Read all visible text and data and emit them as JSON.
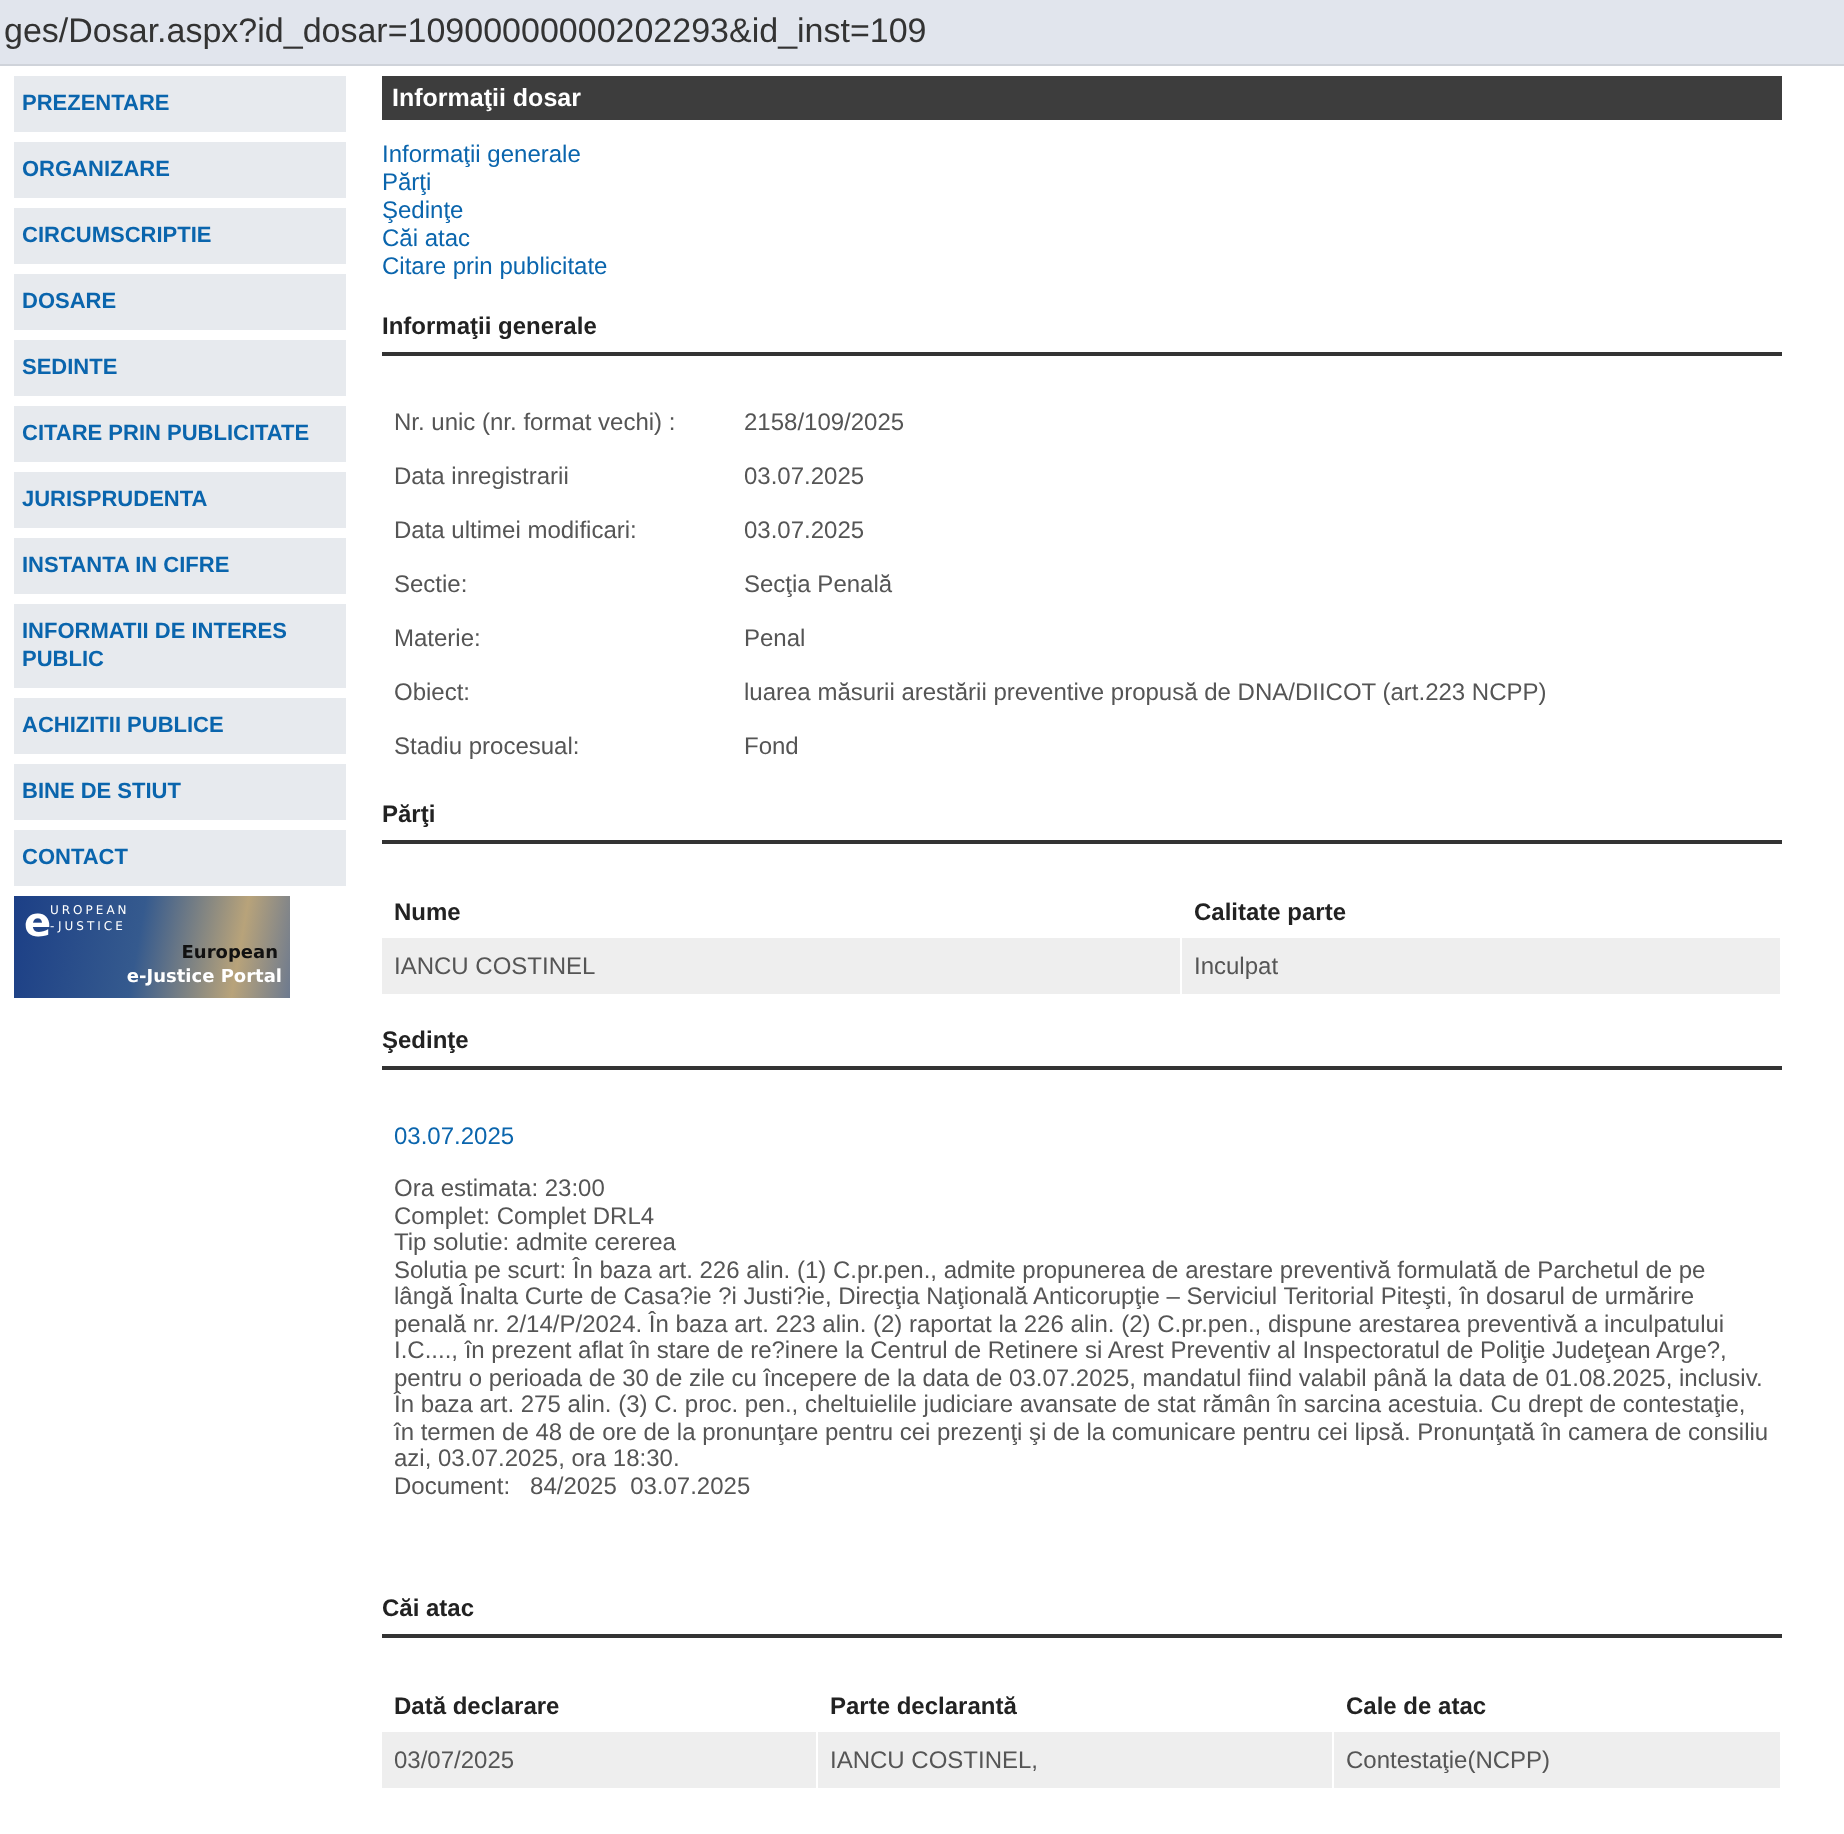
{
  "address_bar": {
    "text": "ges/Dosar.aspx?id_dosar=10900000000202293&id_inst=109"
  },
  "sidebar": {
    "items": [
      {
        "label": "PREZENTARE"
      },
      {
        "label": "ORGANIZARE"
      },
      {
        "label": "CIRCUMSCRIPTIE"
      },
      {
        "label": "DOSARE"
      },
      {
        "label": "SEDINTE"
      },
      {
        "label": "CITARE PRIN PUBLICITATE"
      },
      {
        "label": "JURISPRUDENTA"
      },
      {
        "label": "INSTANTA IN CIFRE"
      },
      {
        "label": "INFORMATII DE INTERES PUBLIC"
      },
      {
        "label": "ACHIZITII PUBLICE"
      },
      {
        "label": "BINE DE STIUT"
      },
      {
        "label": "CONTACT"
      }
    ],
    "banner": {
      "mark": "e",
      "top_line": "UROPEAN",
      "bottom_line": "-JUSTICE",
      "caption_1": "European",
      "caption_2": "e-Justice Portal"
    }
  },
  "panel": {
    "title": "Informaţii dosar",
    "links": [
      "Informaţii generale",
      "Părţi",
      "Şedinţe",
      "Căi atac",
      "Citare prin publicitate"
    ]
  },
  "general": {
    "title": "Informaţii generale",
    "fields": [
      {
        "label": "Nr. unic (nr. format vechi) :",
        "value": "2158/109/2025"
      },
      {
        "label": "Data inregistrarii",
        "value": "03.07.2025"
      },
      {
        "label": "Data ultimei modificari:",
        "value": "03.07.2025"
      },
      {
        "label": "Sectie:",
        "value": "Secţia Penală"
      },
      {
        "label": "Materie:",
        "value": "Penal"
      },
      {
        "label": "Obiect:",
        "value": "luarea măsurii arestării preventive propusă de DNA/DIICOT (art.223 NCPP)"
      },
      {
        "label": "Stadiu procesual:",
        "value": "Fond"
      }
    ]
  },
  "parties": {
    "title": "Părţi",
    "columns": [
      "Nume",
      "Calitate parte"
    ],
    "rows": [
      [
        "IANCU COSTINEL",
        "Inculpat"
      ]
    ]
  },
  "hearings": {
    "title": "Şedinţe",
    "items": [
      {
        "date": "03.07.2025",
        "lines": [
          "Ora estimata: 23:00",
          "Complet: Complet DRL4",
          "Tip solutie: admite cererea",
          "Solutia pe scurt: În baza art. 226 alin. (1) C.pr.pen., admite propunerea de arestare preventivă formulată de Parchetul de pe lângă Înalta Curte de Casa?ie ?i Justi?ie, Direcţia Naţională Anticorupţie – Serviciul Teritorial Piteşti, în dosarul de urmărire penală nr. 2/14/P/2024. În baza art. 223 alin. (2) raportat la 226 alin. (2) C.pr.pen., dispune arestarea preventivă a inculpatului I.C...., în prezent aflat în stare de re?inere la Centrul de Retinere si Arest Preventiv al Inspectoratul de Poliţie Judeţean Arge?, pentru o perioada de 30 de zile cu începere de la data de 03.07.2025, mandatul fiind valabil până la data de 01.08.2025, inclusiv. În baza art. 275 alin. (3) C. proc. pen., cheltuielile judiciare avansate de stat rămân în sarcina acestuia. Cu drept de contestaţie, în termen de 48 de ore de la pronunţare pentru cei prezenţi şi de la comunicare pentru cei lipsă. Pronunţată în camera de consiliu azi, 03.07.2025, ora 18:30.",
          "Document:   84/2025  03.07.2025"
        ]
      }
    ]
  },
  "appeals": {
    "title": "Căi atac",
    "columns": [
      "Dată declarare",
      "Parte declarantă",
      "Cale de atac"
    ],
    "rows": [
      [
        "03/07/2025",
        "IANCU COSTINEL,",
        "Contestaţie(NCPP)"
      ]
    ]
  }
}
